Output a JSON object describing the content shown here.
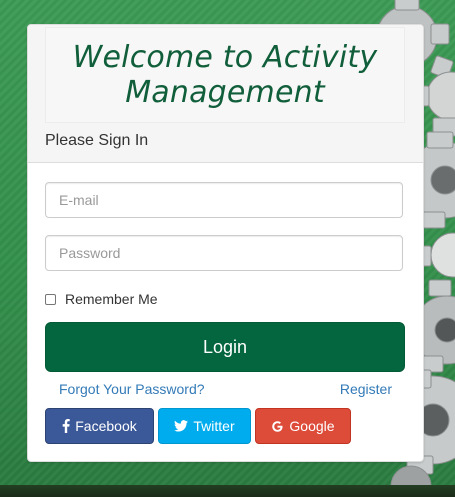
{
  "page": {
    "title": "Welcome to Activity Management"
  },
  "panel": {
    "heading_title": "Please Sign In"
  },
  "form": {
    "email_placeholder": "E-mail",
    "password_placeholder": "Password",
    "remember_label": "Remember Me",
    "remember_checked": false,
    "login_label": "Login"
  },
  "links": {
    "forgot": "Forgot Your Password?",
    "register": "Register"
  },
  "social": {
    "facebook_label": "Facebook",
    "twitter_label": "Twitter",
    "google_label": "Google"
  },
  "colors": {
    "title_green": "#115e3b",
    "login_green": "#03663f",
    "link_blue": "#337ab7",
    "facebook": "#3b5998",
    "twitter": "#00aced",
    "google": "#dd4b39",
    "background_green": "#338f4b"
  },
  "icons": {
    "facebook": "facebook-icon",
    "twitter": "twitter-icon",
    "google": "google-icon",
    "background": "gears-image"
  }
}
